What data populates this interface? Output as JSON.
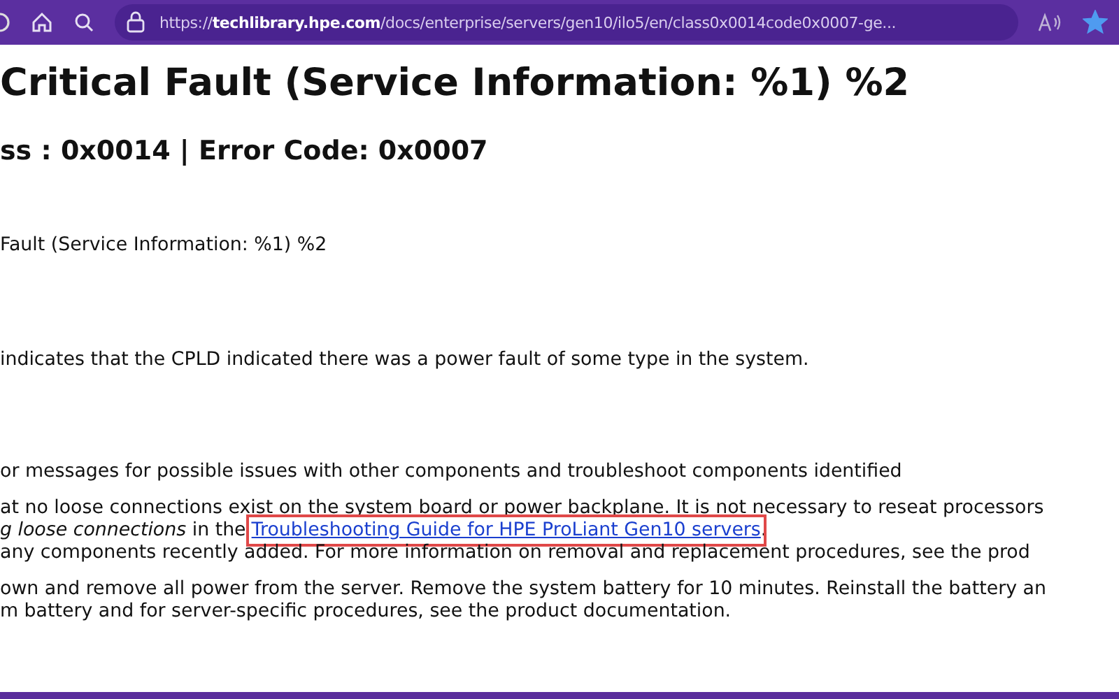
{
  "browser": {
    "url": "https://**techlibrary.hpe.com**/docs/enterprise/servers/gen10/ilo5/en/class0x0014code0x0007-ge...",
    "favorite": true
  },
  "page": {
    "title": "Critical Fault (Service Information: %1) %2",
    "subtitle": "ss : 0x0014 | Error Code: 0x0007",
    "blocks": [
      [
        {
          "kind": "text",
          "text": "Fault (Service Information: %1) %2"
        }
      ],
      [
        {
          "kind": "text",
          "text": "indicates that the CPLD indicated there was a power fault of some type in the system."
        }
      ],
      [
        {
          "kind": "text",
          "text": "or messages for possible issues with other components and troubleshoot components identified"
        }
      ],
      [
        {
          "kind": "text",
          "text": "at no loose connections exist on the system board or power backplane. It is not necessary to reseat processors"
        },
        {
          "kind": "link",
          "text": "*g loose connections* in the",
          "link": "Troubleshooting Guide for HPE ProLiant Gen10 servers",
          "after": ".",
          "highlighted": true
        },
        {
          "kind": "text",
          "text": "any components recently added. For more information on removal and replacement procedures, see the prod"
        }
      ],
      [
        {
          "kind": "text",
          "text": "own and remove all power from the server. Remove the system battery for 10 minutes. Reinstall the battery an"
        },
        {
          "kind": "text",
          "text": "m battery and for server-specific procedures, see the product documentation."
        }
      ]
    ]
  }
}
